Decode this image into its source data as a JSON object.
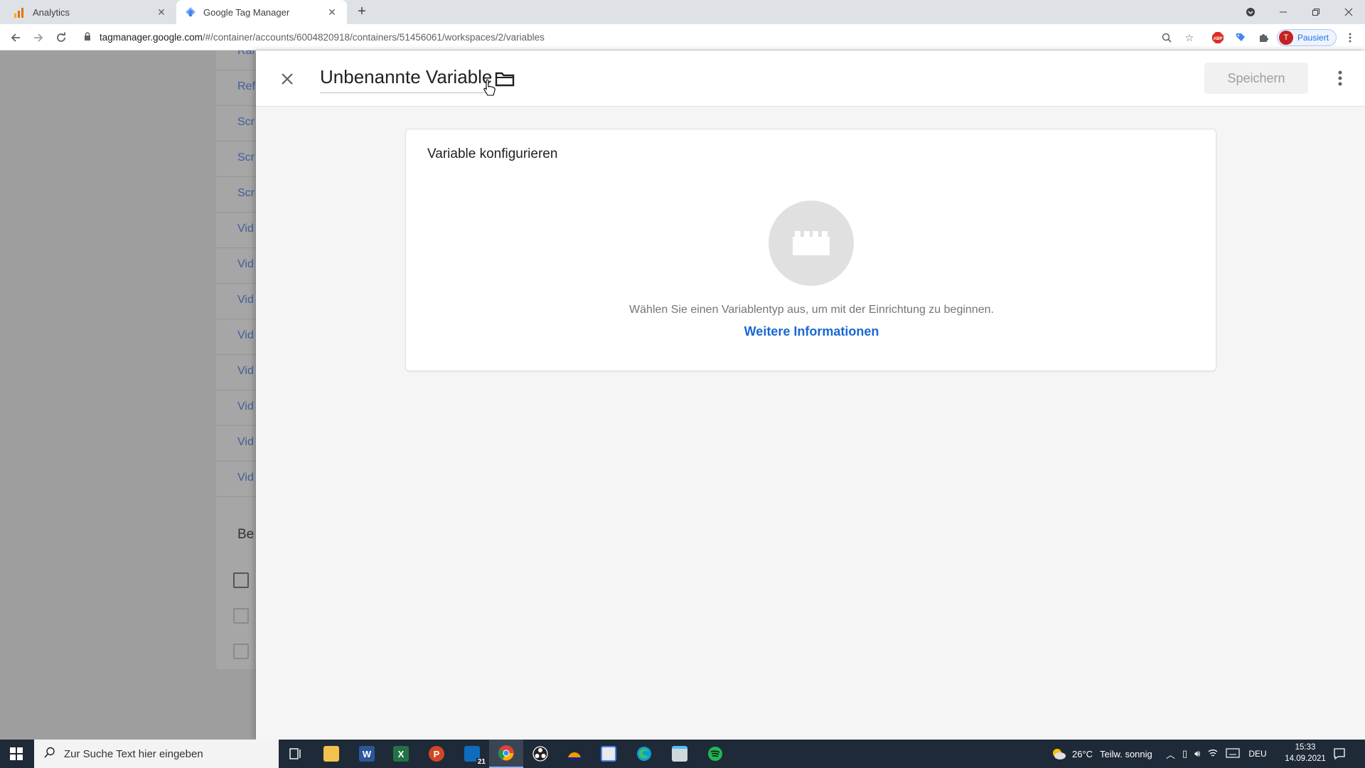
{
  "browser": {
    "tabs": [
      {
        "title": "Analytics",
        "active": false
      },
      {
        "title": "Google Tag Manager",
        "active": true
      }
    ],
    "url_host": "tagmanager.google.com",
    "url_path": "/#/container/accounts/6004820918/containers/51456061/workspaces/2/variables",
    "profile_initial": "T",
    "profile_label": "Pausiert",
    "extensions": [
      "zoom-icon",
      "star-icon",
      "adblock-icon",
      "tag-assistant-icon",
      "puzzle-icon"
    ]
  },
  "background_list": {
    "rows": [
      "Ran",
      "Ref",
      "Scr",
      "Scr",
      "Scr",
      "Vid",
      "Vid",
      "Vid",
      "Vid",
      "Vid",
      "Vid",
      "Vid",
      "Vid"
    ],
    "section_head": "Be"
  },
  "sheet": {
    "variable_name": "Unbenannte Variable",
    "save_label": "Speichern",
    "card_title": "Variable konfigurieren",
    "hint": "Wählen Sie einen Variablentyp aus, um mit der Einrichtung zu beginnen.",
    "more_link": "Weitere Informationen"
  },
  "taskbar": {
    "search_placeholder": "Zur Suche Text hier eingeben",
    "mail_badge": "21",
    "weather": "26°C",
    "weather_desc": "Teilw. sonnig",
    "language": "DEU",
    "time": "15:33",
    "date": "14.09.2021"
  },
  "colors": {
    "link": "#1967d2",
    "taskbar": "#1f2a38",
    "overlay": "#9e9e9e"
  }
}
